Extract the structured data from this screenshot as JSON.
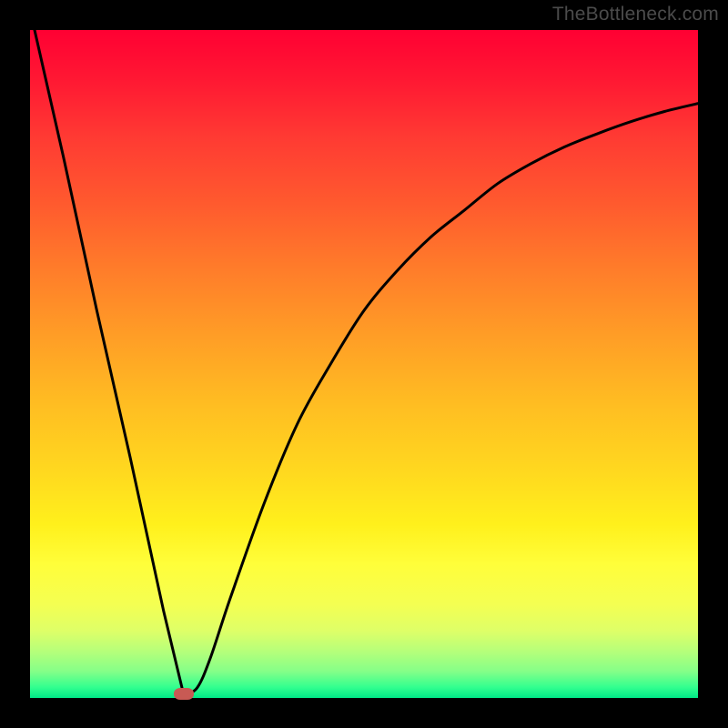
{
  "watermark": "TheBottleneck.com",
  "colors": {
    "frame": "#000000",
    "curve": "#000000",
    "marker": "#c85a54"
  },
  "chart_data": {
    "type": "line",
    "title": "",
    "xlabel": "",
    "ylabel": "",
    "xlim": [
      0,
      100
    ],
    "ylim": [
      0,
      100
    ],
    "grid": false,
    "legend": false,
    "series": [
      {
        "name": "bottleneck-curve",
        "x": [
          0,
          5,
          10,
          15,
          20,
          23,
          25,
          27,
          30,
          35,
          40,
          45,
          50,
          55,
          60,
          65,
          70,
          75,
          80,
          85,
          90,
          95,
          100
        ],
        "values": [
          103,
          81,
          58,
          36,
          13,
          0.5,
          1.5,
          6,
          15,
          29,
          41,
          50,
          58,
          64,
          69,
          73,
          77,
          80,
          82.5,
          84.5,
          86.3,
          87.8,
          89
        ]
      }
    ],
    "marker": {
      "x": 23,
      "y": 0.5
    },
    "note": "Values estimated from pixel positions; y is percent of plot height from bottom, x is percent of plot width from left."
  }
}
